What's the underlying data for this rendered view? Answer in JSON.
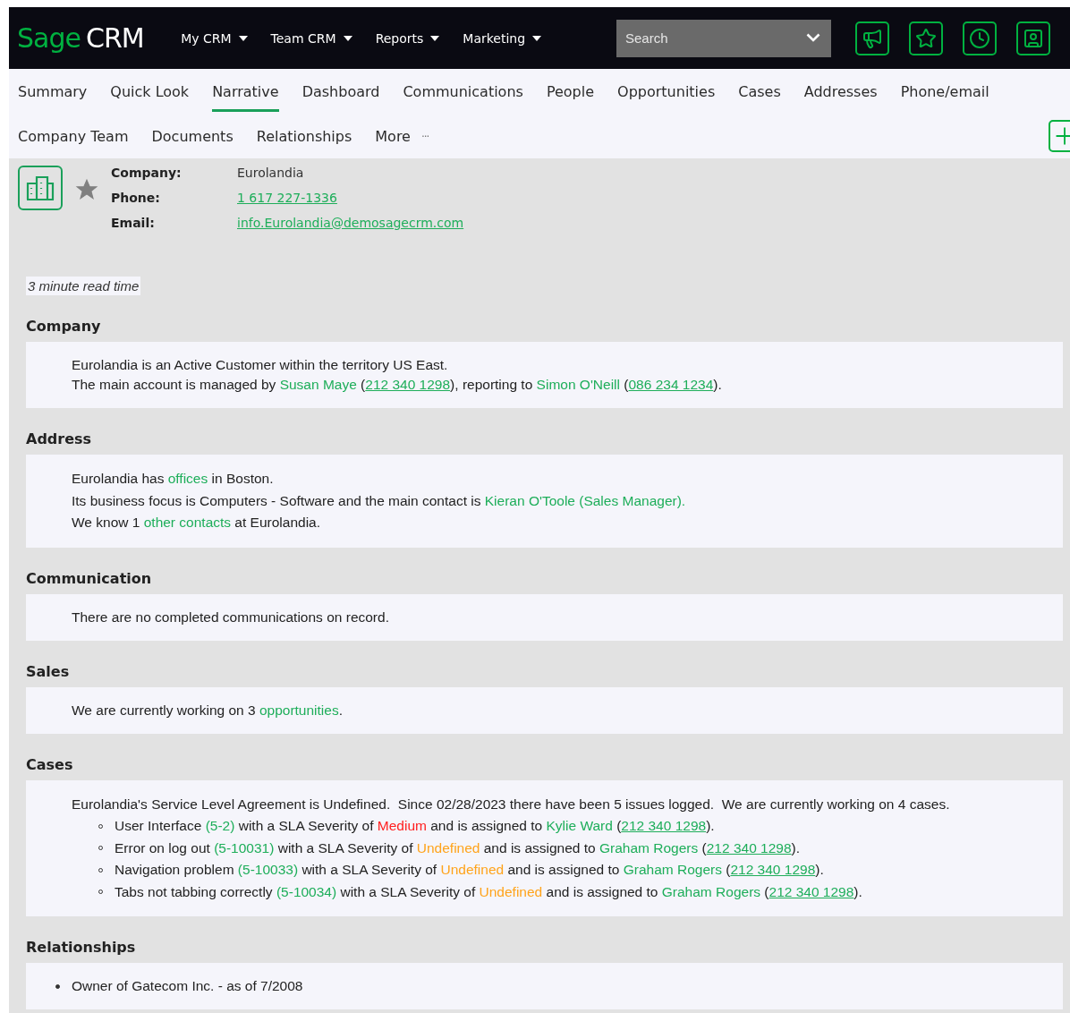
{
  "header": {
    "logo": {
      "brand": "Sage",
      "product": "CRM"
    },
    "menu": [
      {
        "label": "My CRM"
      },
      {
        "label": "Team CRM"
      },
      {
        "label": "Reports"
      },
      {
        "label": "Marketing"
      }
    ],
    "search": {
      "placeholder": "Search"
    },
    "toolbar": [
      {
        "kind": "megaphone"
      },
      {
        "kind": "star"
      },
      {
        "kind": "clock"
      },
      {
        "kind": "user"
      }
    ]
  },
  "tabs": [
    [
      {
        "label": "Summary",
        "selected": false
      },
      {
        "label": "Quick Look",
        "selected": false
      },
      {
        "label": "Narrative",
        "selected": true
      },
      {
        "label": "Dashboard",
        "selected": false
      },
      {
        "label": "Communications",
        "selected": false
      },
      {
        "label": "People",
        "selected": false
      },
      {
        "label": "Opportunities",
        "selected": false
      },
      {
        "label": "Cases",
        "selected": false
      },
      {
        "label": "Addresses",
        "selected": false
      },
      {
        "label": "Phone/email",
        "selected": false
      }
    ],
    [
      {
        "label": "Company Team",
        "selected": false
      },
      {
        "label": "Documents",
        "selected": false
      },
      {
        "label": "Relationships",
        "selected": false
      },
      {
        "label": "More",
        "selected": false,
        "more": "···"
      }
    ]
  ],
  "company": {
    "favorite": true,
    "fields": [
      {
        "label": "Company:",
        "value": "Eurolandia",
        "kind": "text"
      },
      {
        "label": "Phone:",
        "value": "1 617 227-1336",
        "kind": "link"
      },
      {
        "label": "Email:",
        "value": "info.Eurolandia@demosagecrm.com",
        "kind": "link"
      }
    ]
  },
  "read_time": "3 minute read time",
  "sections": [
    {
      "title": "Company",
      "lines": [
        {
          "kind": "text",
          "parts": [
            {
              "kind": "plain",
              "text": "Eurolandia is an Active Customer within the territory US East."
            }
          ]
        },
        {
          "kind": "text",
          "parts": [
            {
              "kind": "plain",
              "text": "The main account is managed by "
            },
            {
              "kind": "link",
              "text": "Susan Maye"
            },
            {
              "kind": "plain",
              "text": " ("
            },
            {
              "kind": "phone",
              "text": "212 340 1298"
            },
            {
              "kind": "plain",
              "text": "), reporting to "
            },
            {
              "kind": "link",
              "text": "Simon O'Neill"
            },
            {
              "kind": "plain",
              "text": " ("
            },
            {
              "kind": "phone",
              "text": "086 234 1234"
            },
            {
              "kind": "plain",
              "text": ")."
            }
          ]
        }
      ]
    },
    {
      "title": "Address",
      "lines": [
        {
          "kind": "text",
          "parts": [
            {
              "kind": "plain",
              "text": "Eurolandia has "
            },
            {
              "kind": "link",
              "text": "offices"
            },
            {
              "kind": "plain",
              "text": " in Boston."
            }
          ]
        },
        {
          "kind": "text",
          "parts": [
            {
              "kind": "plain",
              "text": "Its business focus is Computers - Software and the main contact is "
            },
            {
              "kind": "link",
              "text": "Kieran O'Toole (Sales Manager)."
            }
          ]
        },
        {
          "kind": "text",
          "parts": [
            {
              "kind": "plain",
              "text": "We know 1 "
            },
            {
              "kind": "link",
              "text": "other contacts"
            },
            {
              "kind": "plain",
              "text": " at Eurolandia."
            }
          ]
        }
      ]
    },
    {
      "title": "Communication",
      "lines": [
        {
          "kind": "text",
          "parts": [
            {
              "kind": "plain",
              "text": "There are no completed communications on record."
            }
          ]
        }
      ]
    },
    {
      "title": "Sales",
      "lines": [
        {
          "kind": "text",
          "parts": [
            {
              "kind": "plain",
              "text": "We are currently working on 3 "
            },
            {
              "kind": "link",
              "text": "opportunities"
            },
            {
              "kind": "plain",
              "text": "."
            }
          ]
        }
      ]
    },
    {
      "title": "Cases",
      "lines": [
        {
          "kind": "text",
          "parts": [
            {
              "kind": "plain",
              "text": "Eurolandia's Service Level Agreement is Undefined.  Since 02/28/2023 there have been 5 issues logged.  We are currently working on 4 cases."
            }
          ]
        },
        {
          "kind": "circle-item",
          "parts": [
            {
              "kind": "plain",
              "text": "User Interface "
            },
            {
              "kind": "link",
              "text": "(5-2)"
            },
            {
              "kind": "plain",
              "text": " with a SLA Severity of "
            },
            {
              "kind": "severity",
              "text": "Medium",
              "color": "#ff2020"
            },
            {
              "kind": "plain",
              "text": " and is assigned to "
            },
            {
              "kind": "link",
              "text": "Kylie Ward"
            },
            {
              "kind": "plain",
              "text": " ("
            },
            {
              "kind": "phone",
              "text": "212 340 1298"
            },
            {
              "kind": "plain",
              "text": ")."
            }
          ]
        },
        {
          "kind": "circle-item",
          "parts": [
            {
              "kind": "plain",
              "text": "Error on log out "
            },
            {
              "kind": "link",
              "text": "(5-10031)"
            },
            {
              "kind": "plain",
              "text": " with a SLA Severity of "
            },
            {
              "kind": "severity",
              "text": "Undefined",
              "color": "#ffa31a"
            },
            {
              "kind": "plain",
              "text": " and is assigned to "
            },
            {
              "kind": "link",
              "text": "Graham Rogers"
            },
            {
              "kind": "plain",
              "text": " ("
            },
            {
              "kind": "phone",
              "text": "212 340 1298"
            },
            {
              "kind": "plain",
              "text": ")."
            }
          ]
        },
        {
          "kind": "circle-item",
          "parts": [
            {
              "kind": "plain",
              "text": "Navigation problem "
            },
            {
              "kind": "link",
              "text": "(5-10033)"
            },
            {
              "kind": "plain",
              "text": " with a SLA Severity of "
            },
            {
              "kind": "severity",
              "text": "Undefined",
              "color": "#ffa31a"
            },
            {
              "kind": "plain",
              "text": " and is assigned to "
            },
            {
              "kind": "link",
              "text": "Graham Rogers"
            },
            {
              "kind": "plain",
              "text": " ("
            },
            {
              "kind": "phone",
              "text": "212 340 1298"
            },
            {
              "kind": "plain",
              "text": ")."
            }
          ]
        },
        {
          "kind": "circle-item",
          "parts": [
            {
              "kind": "plain",
              "text": "Tabs not tabbing correctly "
            },
            {
              "kind": "link",
              "text": "(5-10034)"
            },
            {
              "kind": "plain",
              "text": " with a SLA Severity of "
            },
            {
              "kind": "severity",
              "text": "Undefined",
              "color": "#ffa31a"
            },
            {
              "kind": "plain",
              "text": " and is assigned to "
            },
            {
              "kind": "link",
              "text": "Graham Rogers"
            },
            {
              "kind": "plain",
              "text": " ("
            },
            {
              "kind": "phone",
              "text": "212 340 1298"
            },
            {
              "kind": "plain",
              "text": ")."
            }
          ]
        }
      ]
    },
    {
      "title": "Relationships",
      "lines": [
        {
          "kind": "disc-item",
          "parts": [
            {
              "kind": "plain",
              "text": "Owner of Gatecom Inc. - as of 7/2008"
            }
          ]
        }
      ]
    }
  ]
}
